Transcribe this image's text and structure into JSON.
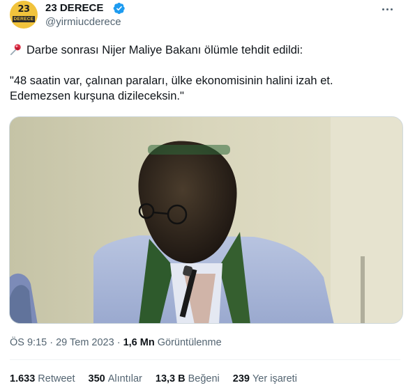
{
  "account": {
    "display_name": "23 DERECE",
    "handle": "@yirmiucderece",
    "avatar_number": "23",
    "avatar_word": "DERECE"
  },
  "tweet": {
    "line1": "Darbe sonrası Nijer Maliye Bakanı ölümle tehdit edildi:",
    "line2": "\"48 saatin var, çalınan paraları, ülke ekonomisinin halini izah et.",
    "line3": "Edemezsen kurşuna dizileceksin.\""
  },
  "meta": {
    "time": "ÖS 9:15",
    "separator1": "·",
    "date": "29 Tem 2023",
    "separator2": "·",
    "views_count": "1,6 Mn",
    "views_label": "Görüntülenme"
  },
  "stats": {
    "retweets_count": "1.633",
    "retweets_label": "Retweet",
    "quotes_count": "350",
    "quotes_label": "Alıntılar",
    "likes_count": "13,3 B",
    "likes_label": "Beğeni",
    "bookmarks_count": "239",
    "bookmarks_label": "Yer işareti"
  },
  "colors": {
    "verified": "#1d9bf0",
    "avatar_bg": "#f1c33c",
    "secondary_text": "#536471",
    "primary_text": "#0f1419"
  },
  "icons": {
    "pin": "pushpin-icon",
    "verified": "verified-badge-icon",
    "more": "more-options-icon"
  }
}
